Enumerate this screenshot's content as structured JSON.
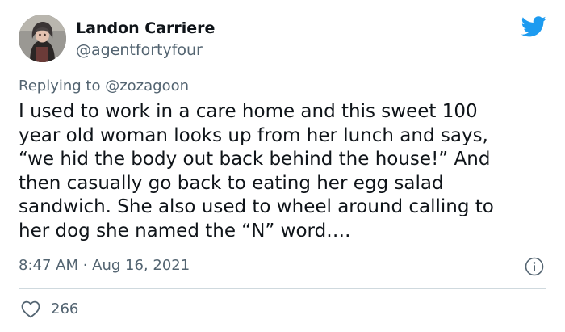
{
  "author": {
    "display_name": "Landon Carriere",
    "handle": "@agentfortyfour"
  },
  "reply": {
    "prefix": "Replying to",
    "target": "@zozagoon"
  },
  "tweet": {
    "text": "I used to work in a care home and this sweet 100\nyear old woman looks up from her lunch and says,\n“we hid the body out back behind the house!” And\nthen casually go back to eating her egg salad\nsandwich. She also used to wheel around calling to\nher dog she named the “N” word….",
    "timestamp": "8:47 AM · Aug 16, 2021"
  },
  "engagement": {
    "likes": "266"
  },
  "icons": {
    "brand": "twitter-bird-icon",
    "info": "info-icon",
    "like": "heart-icon"
  },
  "colors": {
    "brand_blue": "#1d9bf0",
    "secondary_text": "#536471",
    "primary_text": "#0f1419",
    "divider": "#cfd9de"
  }
}
